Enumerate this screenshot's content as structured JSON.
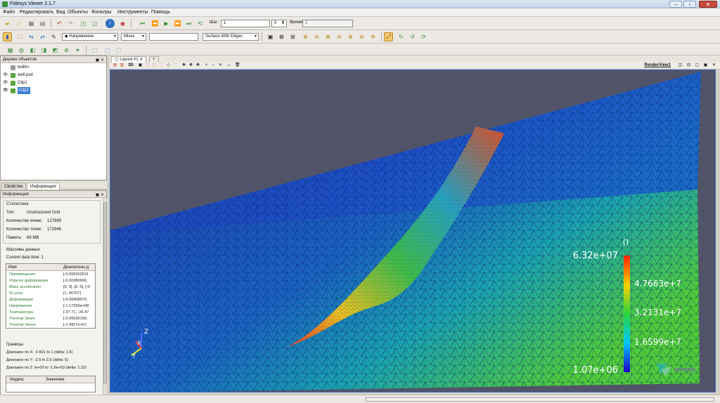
{
  "window": {
    "title": "Fidesys Viewer 2.1.7"
  },
  "menu": [
    "Файл",
    "Редактировать",
    "Вид",
    "Объекты",
    "Фильтры",
    "Инструменты",
    "Помощь"
  ],
  "toolbar1": {
    "step_label": "Шаг:",
    "step_value": "1",
    "step_spin": "0",
    "time_label": "Время:",
    "time_value": "1"
  },
  "toolbar2": {
    "variable_select": "Напряжения",
    "component_select": "Mises",
    "representation_select": "Surface With Edges"
  },
  "pipeline": {
    "header": "Дерево объектов",
    "items": [
      {
        "label": "builtin:"
      },
      {
        "label": "well.pvd"
      },
      {
        "label": "Clip1"
      },
      {
        "label": "Clip2"
      }
    ]
  },
  "left_tabs": [
    "Свойства",
    "Информация"
  ],
  "info": {
    "header": "Информация",
    "stats_title": "Статистика",
    "stats": [
      {
        "label": "Тип:",
        "value": "Unstructured Grid"
      },
      {
        "label": "Количество ячеек:",
        "value": "127899"
      },
      {
        "label": "Количество точек:",
        "value": "172946"
      },
      {
        "label": "Память:",
        "value": "89 MB"
      }
    ],
    "arrays_title": "Массивы данных",
    "current_time": "Current data time: 1",
    "arrays_header": {
      "name": "Имя",
      "range": "Диапазоны д"
    },
    "arrays": [
      {
        "name": "Перемещения",
        "range": "[-0.000053531"
      },
      {
        "name": "Упругие деформации",
        "range": "[-0.00380669,"
      },
      {
        "name": "Mass acceleration",
        "range": "[0, 0], [0, 0], [-0"
      },
      {
        "name": "ID узла",
        "range": "[1, 45707]"
      },
      {
        "name": "Деформации",
        "range": "[-0.00408973,"
      },
      {
        "name": "Напряжения",
        "range": "[-1.17293e+08"
      },
      {
        "name": "Температура",
        "range": "[-37.71, -26.47"
      },
      {
        "name": "Thermal Strain",
        "range": "[-0.00030168,"
      },
      {
        "name": "Thermal Stress",
        "range": "[-1.4927e+07,"
      }
    ],
    "bounds_title": "Границы",
    "bounds": [
      "Диапазон по X:  -0.501 to 1 (delta: 1.5)",
      "Диапазон по Y:  -2.5 to 2.5 (delta: 5)",
      "Диапазон по Z:  ie+03 to -1.6e+03 (delta: 1.22)"
    ],
    "index_header": {
      "index": "Индекс",
      "value": "Значение"
    }
  },
  "layout": {
    "tab_label": "Layout #1",
    "renderview_label": "RenderView1"
  },
  "colorbar": {
    "title": "()",
    "labels": [
      "6.32e+07",
      "4.7663e+7",
      "3.2131e+7",
      "1.6599e+7",
      "1.07e+06"
    ]
  },
  "axes": {
    "x": "X",
    "y": "Y",
    "z": "Z"
  },
  "colors": {
    "background": "#515468",
    "selection": "#3d7ed6"
  }
}
